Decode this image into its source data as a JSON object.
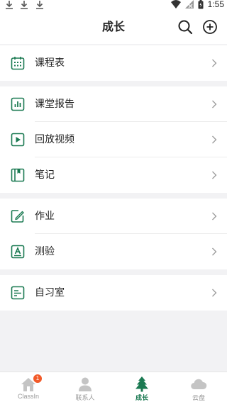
{
  "status_bar": {
    "time": "1:55"
  },
  "header": {
    "title": "成长"
  },
  "menu_groups": [
    [
      {
        "label": "课程表",
        "icon": "calendar-icon"
      }
    ],
    [
      {
        "label": "课堂报告",
        "icon": "report-chart-icon"
      },
      {
        "label": "回放视频",
        "icon": "play-video-icon"
      },
      {
        "label": "笔记",
        "icon": "notebook-icon"
      }
    ],
    [
      {
        "label": "作业",
        "icon": "homework-edit-icon"
      },
      {
        "label": "测验",
        "icon": "quiz-icon"
      }
    ],
    [
      {
        "label": "自习室",
        "icon": "study-room-icon"
      }
    ]
  ],
  "tabbar": {
    "tabs": [
      {
        "label": "ClassIn",
        "icon": "home-icon",
        "badge": "1"
      },
      {
        "label": "联系人",
        "icon": "contacts-icon"
      },
      {
        "label": "成长",
        "icon": "tree-icon",
        "active": true
      },
      {
        "label": "云盘",
        "icon": "cloud-icon"
      }
    ]
  },
  "colors": {
    "accent": "#1b7a52",
    "badge": "#f25a29",
    "background": "#f2f2f4"
  }
}
